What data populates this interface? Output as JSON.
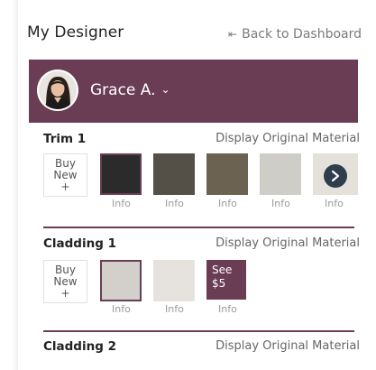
{
  "header": {
    "title": "My Designer",
    "back_label": "Back to Dashboard",
    "back_icon": "arrow-left-bar-icon"
  },
  "user": {
    "name": "Grace A.",
    "dropdown_icon": "chevron-down-icon",
    "bar_color": "#6a3d54"
  },
  "sections": [
    {
      "title": "Trim 1",
      "display_original": "Display Original Material",
      "buy_new": [
        "Buy",
        "New",
        "+"
      ],
      "swatches": [
        {
          "color": "#2b2b2b",
          "info": "Info",
          "selected": true
        },
        {
          "color": "#545048",
          "info": "Info",
          "selected": false
        },
        {
          "color": "#6b6252",
          "info": "Info",
          "selected": false
        },
        {
          "color": "#cfcdc8",
          "info": "Info",
          "selected": false
        },
        {
          "color": "#e4e1db",
          "info": "Info",
          "selected": false
        }
      ],
      "next_icon": "chevron-right-icon"
    },
    {
      "title": "Cladding 1",
      "display_original": "Display Original Material",
      "buy_new": [
        "Buy",
        "New",
        "+"
      ],
      "swatches": [
        {
          "color": "#d3d0cb",
          "info": "Info",
          "selected": true
        },
        {
          "color": "#e6e3de",
          "info": "Info",
          "selected": false
        }
      ],
      "see_more": {
        "line1": "See",
        "line2": "$5",
        "info": "Info"
      }
    },
    {
      "title": "Cladding 2",
      "display_original": "Display Original Material"
    }
  ]
}
